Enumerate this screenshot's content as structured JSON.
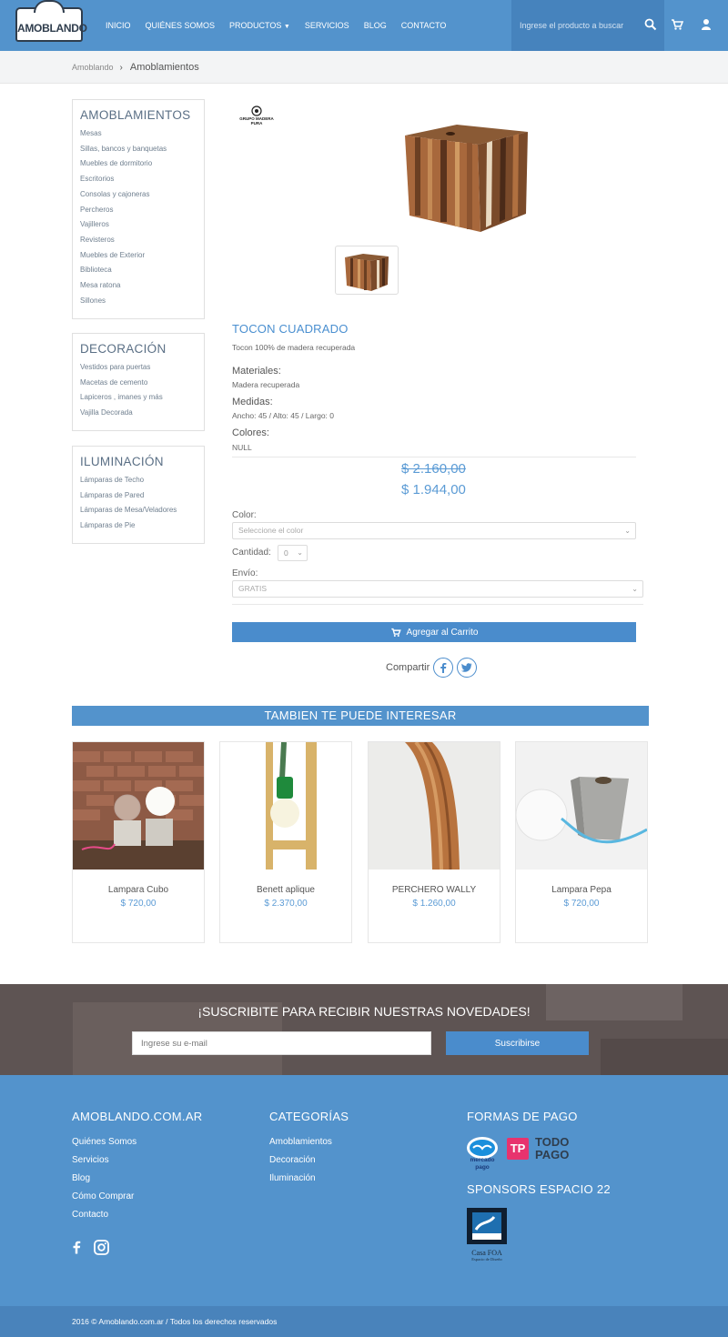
{
  "header": {
    "logo_text": "AMOBLANDO",
    "nav": [
      "INICIO",
      "QUIÉNES SOMOS",
      "PRODUCTOS",
      "SERVICIOS",
      "BLOG",
      "CONTACTO"
    ],
    "search_placeholder": "Ingrese el producto a buscar",
    "icons": [
      "search-icon",
      "cart-icon",
      "user-icon"
    ]
  },
  "breadcrumb": {
    "home": "Amoblando",
    "current": "Amoblamientos"
  },
  "sidebar": {
    "amoblamientos": {
      "title": "AMOBLAMIENTOS",
      "items": [
        "Mesas",
        "Sillas, bancos y banquetas",
        "Muebles de dormitorio",
        "Escritorios",
        "Consolas y cajoneras",
        "Percheros",
        "Vajilleros",
        "Revisteros",
        "Muebles de Exterior",
        "Biblioteca",
        "Mesa ratona",
        "Sillones"
      ]
    },
    "decoracion": {
      "title": "DECORACIÓN",
      "items": [
        "Vestidos para puertas",
        "Macetas de cemento",
        "Lapiceros , imanes y más",
        "Vajilla Decorada"
      ]
    },
    "iluminacion": {
      "title": "ILUMINACIÓN",
      "items": [
        "Lámparas de Techo",
        "Lámparas de Pared",
        "Lámparas de Mesa/Veladores",
        "Lámparas de Pie"
      ]
    }
  },
  "product": {
    "brand": "GRUPO MADERA PURA",
    "title": "TOCON CUADRADO",
    "description": "Tocon 100% de madera recuperada",
    "materials_label": "Materiales:",
    "materials_value": "Madera recuperada",
    "measures_label": "Medidas:",
    "measures_value": "Ancho: 45 / Alto: 45 / Largo: 0",
    "colors_label": "Colores:",
    "colors_value": "NULL",
    "old_price": "$ 2.160,00",
    "new_price": "$ 1.944,00",
    "color_label": "Color:",
    "color_placeholder": "Seleccione el color",
    "qty_label": "Cantidad:",
    "qty_value": "0",
    "shipping_label": "Envío:",
    "shipping_value": "GRATIS",
    "add_to_cart": "Agregar al Carrito",
    "share_label": "Compartir"
  },
  "related": {
    "title": "TAMBIEN TE PUEDE INTERESAR",
    "items": [
      {
        "name": "Lampara Cubo",
        "price": "$ 720,00"
      },
      {
        "name": "Benett aplique",
        "price": "$ 2.370,00"
      },
      {
        "name": "PERCHERO WALLY",
        "price": "$ 1.260,00"
      },
      {
        "name": "Lampara Pepa",
        "price": "$ 720,00"
      }
    ]
  },
  "newsletter": {
    "title": "¡SUSCRIBITE PARA RECIBIR NUESTRAS NOVEDADES!",
    "placeholder": "Ingrese su e-mail",
    "button": "Suscribirse"
  },
  "footer": {
    "col1_title": "AMOBLANDO.COM.AR",
    "col1_links": [
      "Quiénes Somos",
      "Servicios",
      "Blog",
      "Cómo Comprar",
      "Contacto"
    ],
    "col2_title": "CATEGORÍAS",
    "col2_links": [
      "Amoblamientos",
      "Decoración",
      "Iluminación"
    ],
    "col3_title": "FORMAS DE PAGO",
    "mercado_logo_text": "mercado pago",
    "todopago_text_1": "TODO",
    "todopago_text_2": "PAGO",
    "sponsors_title": "SPONSORS ESPACIO 22",
    "casafoa_text": "Casa FOA",
    "casafoa_sub": "Espacio de Diseño",
    "copyright": "2016 © Amoblando.com.ar / Todos los derechos reservados"
  },
  "colors": {
    "primary": "#5393cc",
    "price": "#5b9bd5",
    "footer_dark": "#4983bb"
  }
}
